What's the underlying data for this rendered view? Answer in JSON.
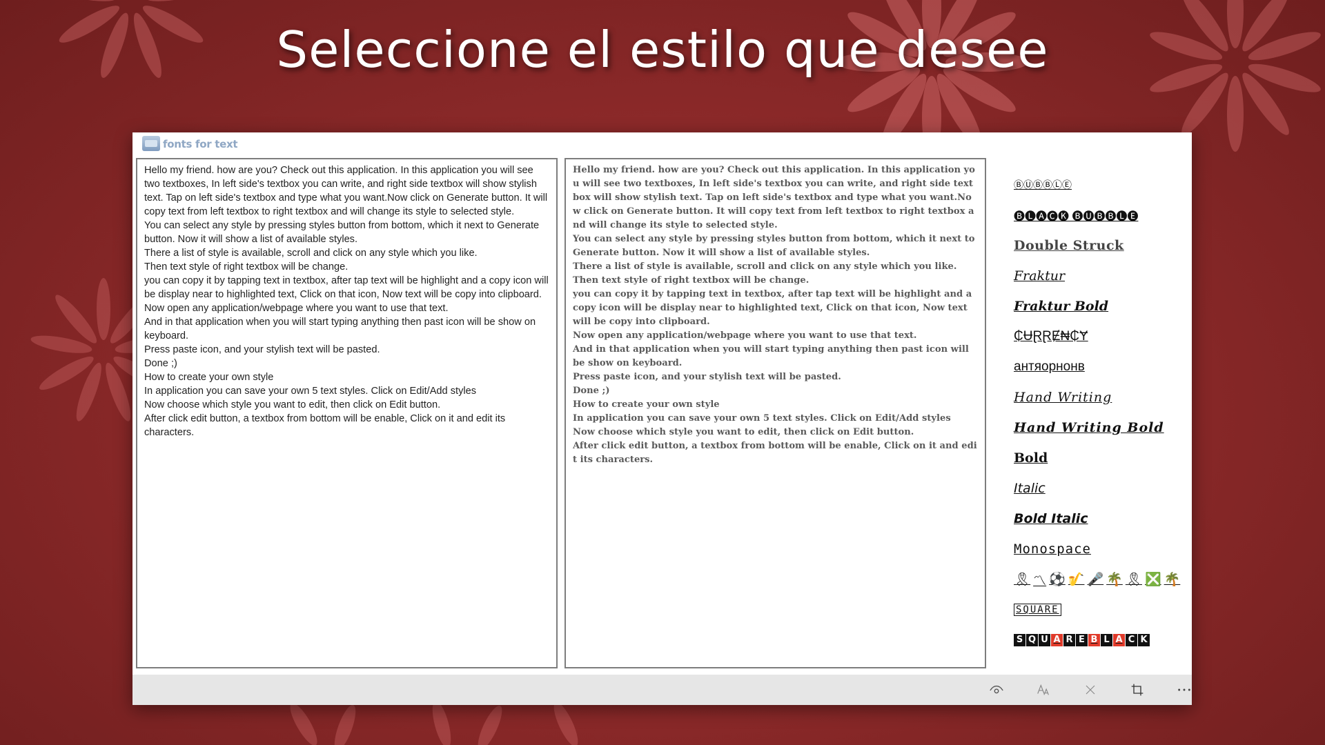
{
  "headline": "Seleccione el estilo que desee",
  "app": {
    "logo_text": "fonts for text"
  },
  "left_text": "Hello my friend. how are you? Check out this application. In this application you will see two textboxes, In left side's textbox you can write, and right side textbox will show stylish text. Tap on left side's textbox and type what you want.Now click on Generate button. It will copy text from left textbox to right textbox and will change its style to selected style.\nYou can select any style by pressing styles button from bottom, which it next to Generate button. Now it will show a list of available styles.\nThere a list of style is available, scroll and click on any style which you like.\nThen text style of right textbox will be change.\nyou can copy it by tapping text in textbox, after tap text will be highlight and a copy icon will be display near to highlighted text, Click on that icon, Now text will be copy into clipboard.\nNow open any application/webpage where you want to use that text.\nAnd in that application when you will start typing anything then past icon will be show on keyboard.\nPress paste icon, and your stylish text will be pasted.\nDone ;)\nHow to create your own style\nIn application you can save your own 5 text styles. Click on Edit/Add styles\nNow choose which style you want to edit, then click on Edit button.\nAfter click edit button, a textbox from bottom will be enable, Click on it and edit its characters.",
  "right_text": "Hello my friend. how are you? Check out this application. In this application you will see two textboxes, In left side's textbox you can write, and right side textbox will show stylish text. Tap on left side's textbox and type what you want.Now click on Generate button. It will copy text from left textbox to right textbox and will change its style to selected style.\nYou can select any style by pressing styles button from bottom, which it next to Generate button. Now it will show a list of available styles.\nThere a list of style is available, scroll and click on any style which you like.\nThen text style of right textbox will be change.\nyou can copy it by tapping text in textbox, after tap text will be highlight and a copy icon will be display near to highlighted text, Click on that icon, Now text will be copy into clipboard.\nNow open any application/webpage where you want to use that text.\nAnd in that application when you will start typing anything then past icon will be show on keyboard.\nPress paste icon, and your stylish text will be pasted.\nDone ;)\nHow to create your own style\nIn application you can save your own 5 text styles. Click on Edit/Add styles\nNow choose which style you want to edit, then click on Edit button.\nAfter click edit button, a textbox from bottom will be enable, Click on it and edit its characters.",
  "styles": {
    "bubble": "ⒷⓊⒷⒷⓁⒺ",
    "black_bubble": "🅑🅛🅐🅒🅚 🅑🅤🅑🅑🅛🅔",
    "double_struck": "Double Struck",
    "fraktur": "Fraktur",
    "fraktur_bold": "Fraktur Bold",
    "currency": "₵ɄⱤⱤɆ₦₵Ɏ",
    "upside": "антяорнонв",
    "hand_writing": "Hand Writing",
    "hand_writing_bold": "Hand Writing Bold",
    "bold": "Bold",
    "italic": "Italic",
    "bold_italic": "Bold Italic",
    "monospace": "Monospace",
    "emoji": [
      "🎗",
      "〽",
      "⚽",
      "🎷",
      "🎤",
      "🌴",
      "🎗",
      "❎",
      "🌴"
    ],
    "square": "SQUARE",
    "square_black": [
      "S",
      "Q",
      "U",
      "A",
      "R",
      "E",
      "B",
      "L",
      "A",
      "C",
      "K"
    ]
  },
  "colors": {
    "accent_red": "#e03a2a",
    "background": "#8e2a2a"
  },
  "toolbar_icons": [
    "eye-icon",
    "font-size-icon",
    "close-icon",
    "crop-icon",
    "more-icon"
  ]
}
